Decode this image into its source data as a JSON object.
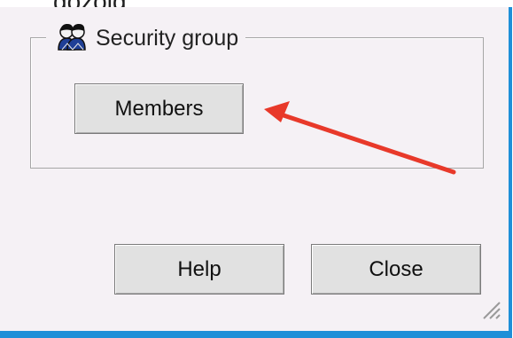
{
  "top_text": "gozoig.",
  "group": {
    "icon": "security-group-icon",
    "label": "Security group",
    "members_button": "Members"
  },
  "footer": {
    "help_button": "Help",
    "close_button": "Close"
  },
  "annotation": {
    "arrow_color": "#e8392a"
  },
  "colors": {
    "window_background": "#f5f1f5",
    "window_border_accent": "#1e8fd8",
    "button_face": "#e1e1e1"
  }
}
